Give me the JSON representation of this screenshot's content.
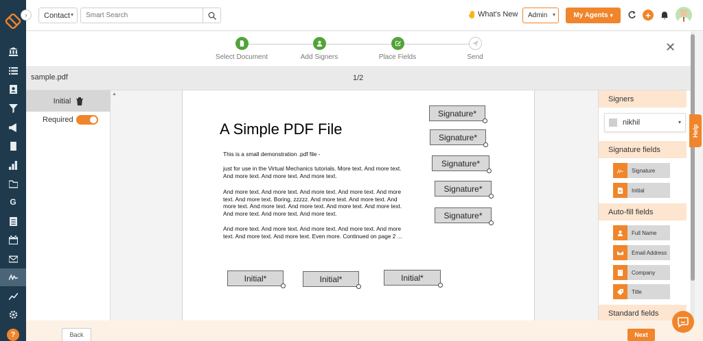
{
  "header": {
    "contact_label": "Contact",
    "search_placeholder": "Smart Search",
    "whats_new": "What's New",
    "admin_label": "Admin",
    "agents_label": "My Agents"
  },
  "stepper": {
    "steps": [
      {
        "label": "Select Document",
        "state": "done"
      },
      {
        "label": "Add Signers",
        "state": "done"
      },
      {
        "label": "Place Fields",
        "state": "done"
      },
      {
        "label": "Send",
        "state": "pending"
      }
    ]
  },
  "file": {
    "name": "sample.pdf",
    "page_indicator": "1/2"
  },
  "field_panel": {
    "field_label": "Initial",
    "required_label": "Required",
    "required_on": true
  },
  "document": {
    "title": "A Simple PDF File",
    "paragraphs": [
      "This is a small demonstration .pdf file -",
      "just for use in the Virtual Mechanics tutorials. More text. And more text. And more text. And more text. And more text.",
      "And more text. And more text. And more text. And more text. And more text. And more text. Boring, zzzzz. And more text. And more text. And more text. And more text. And more text. And more text. And more text. And more text. And more text. And more text.",
      "And more text. And more text. And more text. And more text. And more text. And more text. And more text. Even more. Continued on page 2 ..."
    ],
    "signature_fields": [
      "Signature*",
      "Signature*",
      "Signature*",
      "Signature*",
      "Signature*"
    ],
    "initial_fields": [
      "Initial*",
      "Initial*",
      "Initial*"
    ]
  },
  "right_panel": {
    "signers_heading": "Signers",
    "signer_name": "nikhil",
    "signature_heading": "Signature fields",
    "signature_items": [
      {
        "label": "Signature",
        "icon": "signature-icon"
      },
      {
        "label": "Initial",
        "icon": "initial-icon"
      }
    ],
    "autofill_heading": "Auto-fill fields",
    "autofill_items": [
      {
        "label": "Full Name",
        "icon": "person-icon"
      },
      {
        "label": "Email Address",
        "icon": "envelope-icon"
      },
      {
        "label": "Company",
        "icon": "building-icon"
      },
      {
        "label": "Title",
        "icon": "tag-icon"
      }
    ],
    "standard_heading": "Standard fields"
  },
  "help_tab": "Help",
  "footer": {
    "back_label": "Back",
    "next_label": "Next"
  },
  "colors": {
    "accent": "#f0852b",
    "rail": "#1f3a4d",
    "step_done": "#52a33a"
  }
}
